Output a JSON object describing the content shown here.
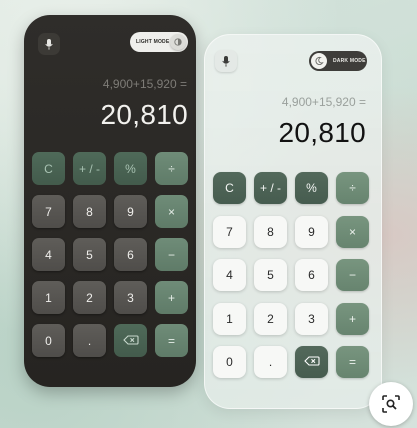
{
  "dark_calculator": {
    "mode_toggle_label": "LIGHT MODE",
    "expression": "4,900+15,920 =",
    "result": "20,810",
    "keys": [
      {
        "label": "C",
        "kind": "fn"
      },
      {
        "label": "+ / -",
        "kind": "fn"
      },
      {
        "label": "%",
        "kind": "fn"
      },
      {
        "label": "÷",
        "kind": "op"
      },
      {
        "label": "7",
        "kind": "num"
      },
      {
        "label": "8",
        "kind": "num"
      },
      {
        "label": "9",
        "kind": "num"
      },
      {
        "label": "×",
        "kind": "op"
      },
      {
        "label": "4",
        "kind": "num"
      },
      {
        "label": "5",
        "kind": "num"
      },
      {
        "label": "6",
        "kind": "num"
      },
      {
        "label": "−",
        "kind": "op"
      },
      {
        "label": "1",
        "kind": "num"
      },
      {
        "label": "2",
        "kind": "num"
      },
      {
        "label": "3",
        "kind": "num"
      },
      {
        "label": "+",
        "kind": "op"
      },
      {
        "label": "0",
        "kind": "num"
      },
      {
        "label": ".",
        "kind": "num"
      },
      {
        "label": "",
        "kind": "fn",
        "icon": "backspace-icon"
      },
      {
        "label": "=",
        "kind": "op"
      }
    ]
  },
  "light_calculator": {
    "mode_toggle_label": "DARK MODE",
    "expression": "4,900+15,920 =",
    "result": "20,810",
    "keys": [
      {
        "label": "C",
        "kind": "fn"
      },
      {
        "label": "+ / -",
        "kind": "fn"
      },
      {
        "label": "%",
        "kind": "fn"
      },
      {
        "label": "÷",
        "kind": "op"
      },
      {
        "label": "7",
        "kind": "num"
      },
      {
        "label": "8",
        "kind": "num"
      },
      {
        "label": "9",
        "kind": "num"
      },
      {
        "label": "×",
        "kind": "op"
      },
      {
        "label": "4",
        "kind": "num"
      },
      {
        "label": "5",
        "kind": "num"
      },
      {
        "label": "6",
        "kind": "num"
      },
      {
        "label": "−",
        "kind": "op"
      },
      {
        "label": "1",
        "kind": "num"
      },
      {
        "label": "2",
        "kind": "num"
      },
      {
        "label": "3",
        "kind": "num"
      },
      {
        "label": "+",
        "kind": "op"
      },
      {
        "label": "0",
        "kind": "num"
      },
      {
        "label": ".",
        "kind": "num"
      },
      {
        "label": "",
        "kind": "fn",
        "icon": "backspace-icon"
      },
      {
        "label": "=",
        "kind": "op"
      }
    ]
  },
  "icons": {
    "mic": "microphone-icon",
    "sun": "sun-icon",
    "moon": "moon-icon",
    "backspace": "backspace-icon",
    "lens": "search-lens-icon"
  },
  "colors": {
    "dark_panel": "#2f2d2a",
    "accent_green": "#6f8c78",
    "function_green": "#4f6a59"
  }
}
